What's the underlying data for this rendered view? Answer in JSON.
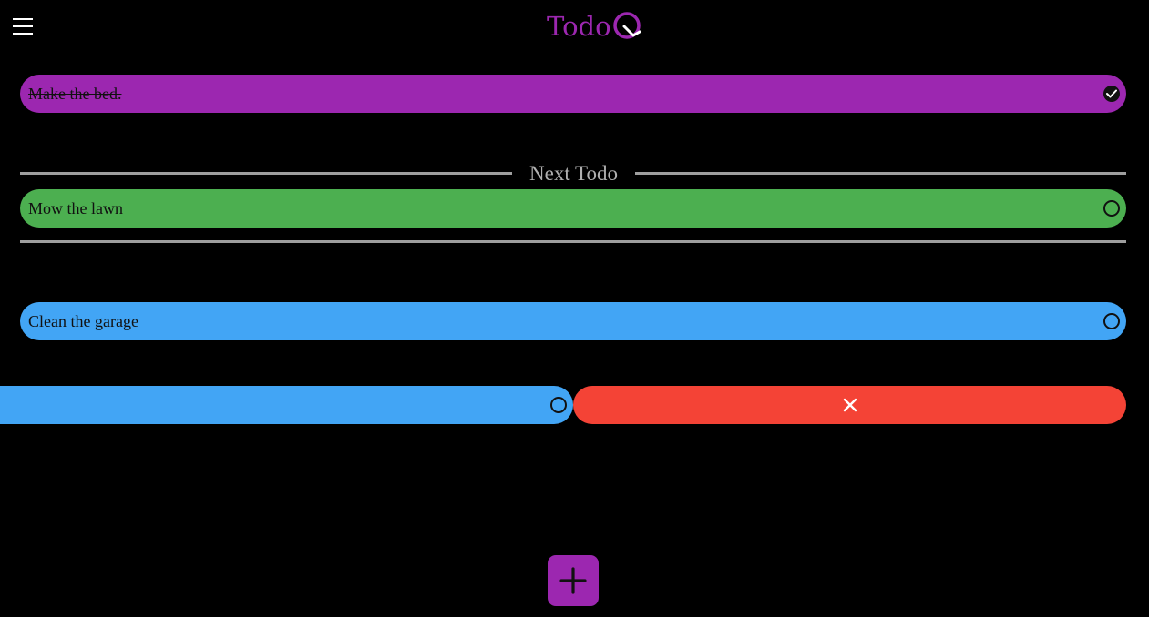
{
  "colors": {
    "background": "#000000",
    "brand": "#9c27b0",
    "done": "#9c27b0",
    "next": "#4caf50",
    "pending": "#42a5f5",
    "delete": "#f44336",
    "divider": "#9e9e9e"
  },
  "header": {
    "menu_icon": "hamburger-menu-icon",
    "logo_text": "Todo",
    "logo_icon": "q-checkmark-logo-icon"
  },
  "todos": {
    "done": {
      "text": "Make the bed.",
      "status": "completed",
      "icon": "check-circle-icon"
    },
    "next": {
      "text": "Mow the lawn",
      "status": "open",
      "icon": "circle-outline-icon"
    },
    "pending": {
      "text": "Clean the garage",
      "status": "open",
      "icon": "circle-outline-icon"
    },
    "swiped": {
      "text": "",
      "status": "open",
      "icon": "circle-outline-icon",
      "delete_icon": "close-x-icon"
    }
  },
  "next_section": {
    "label": "Next Todo"
  },
  "fab": {
    "icon": "plus-icon"
  }
}
